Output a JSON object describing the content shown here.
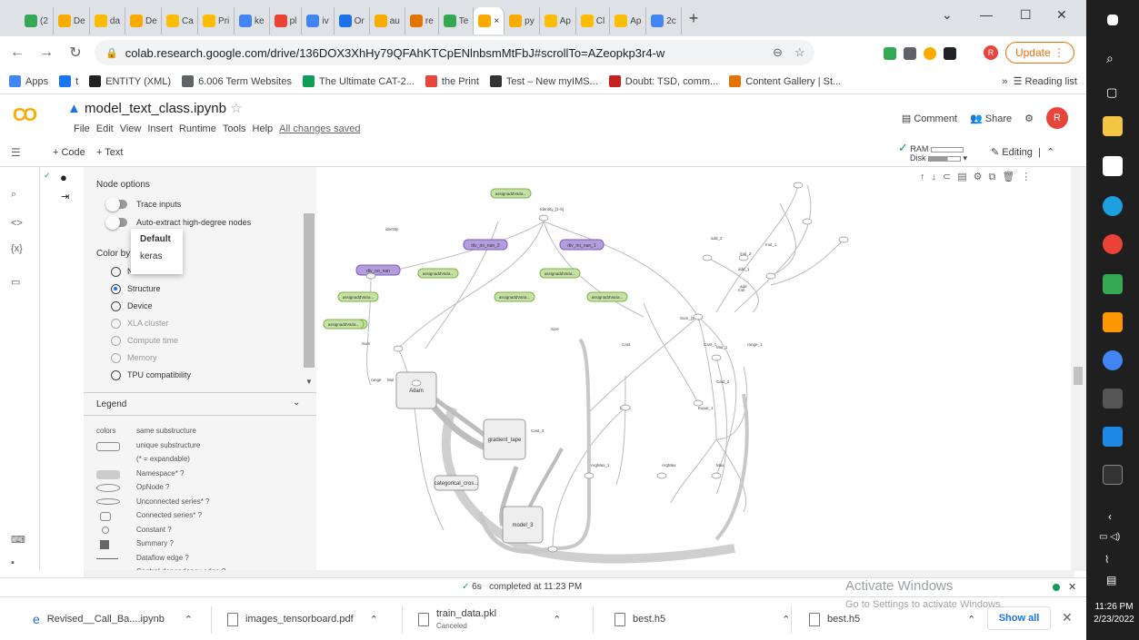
{
  "browser": {
    "tabs": [
      {
        "label": "(2",
        "color": "#34a853"
      },
      {
        "label": "De",
        "color": "#f9ab00"
      },
      {
        "label": "da",
        "color": "#fbbc04"
      },
      {
        "label": "De",
        "color": "#f9ab00"
      },
      {
        "label": "Ca",
        "color": "#fbbc04"
      },
      {
        "label": "Pri",
        "color": "#fbbc04"
      },
      {
        "label": "ke",
        "color": "#4285f4"
      },
      {
        "label": "pl",
        "color": "#ea4335"
      },
      {
        "label": "iv",
        "color": "#4285f4"
      },
      {
        "label": "Or",
        "color": "#1a73e8"
      },
      {
        "label": "au",
        "color": "#f9ab00"
      },
      {
        "label": "re",
        "color": "#e37400"
      },
      {
        "label": "Te",
        "color": "#34a853"
      },
      {
        "label": "×",
        "color": "#f9ab00",
        "active": true
      },
      {
        "label": "py",
        "color": "#f9ab00"
      },
      {
        "label": "Ap",
        "color": "#fbbc04"
      },
      {
        "label": "Cl",
        "color": "#fbbc04"
      },
      {
        "label": "Ap",
        "color": "#fbbc04"
      },
      {
        "label": "2c",
        "color": "#4285f4"
      }
    ],
    "url": "colab.research.google.com/drive/136DOX3XhHy79QFAhKTCpENlnbsmMtFbJ#scrollTo=AZeopkp3r4-w",
    "update_label": "Update",
    "profile_initial": "R",
    "bookmarks": [
      {
        "label": "Apps",
        "color": "#4285f4"
      },
      {
        "label": "t",
        "color": "#1877f2"
      },
      {
        "label": "ENTITY (XML)",
        "color": "#222222"
      },
      {
        "label": "6.006 Term Websites",
        "color": "#5f6368"
      },
      {
        "label": "The Ultimate CAT-2...",
        "color": "#0f9d58"
      },
      {
        "label": "the Print",
        "color": "#e8453c"
      },
      {
        "label": "Test – New myIMS...",
        "color": "#333333"
      },
      {
        "label": "Doubt: TSD, comm...",
        "color": "#c5221f"
      },
      {
        "label": "Content Gallery | St...",
        "color": "#e37400"
      }
    ],
    "reading_list": "Reading list"
  },
  "colab": {
    "notebook_title": "model_text_class.ipynb",
    "menus": [
      "File",
      "Edit",
      "View",
      "Insert",
      "Runtime",
      "Tools",
      "Help"
    ],
    "saved_status": "All changes saved",
    "comment_label": "Comment",
    "share_label": "Share",
    "user_initial": "R",
    "add_code": "+ Code",
    "add_text": "+ Text",
    "ram_label": "RAM",
    "disk_label": "Disk",
    "editing_label": "Editing"
  },
  "tensorboard": {
    "node_options_title": "Node options",
    "trace_inputs": "Trace inputs",
    "auto_extract": "Auto-extract high-degree nodes",
    "color_by_label": "Color by",
    "dropdown_options": [
      "Default",
      "keras"
    ],
    "color_options": [
      {
        "label": "N",
        "selected": false,
        "dim": false
      },
      {
        "label": "Structure",
        "selected": true,
        "dim": false
      },
      {
        "label": "Device",
        "selected": false,
        "dim": false
      },
      {
        "label": "XLA cluster",
        "selected": false,
        "dim": true
      },
      {
        "label": "Compute time",
        "selected": false,
        "dim": true
      },
      {
        "label": "Memory",
        "selected": false,
        "dim": true
      },
      {
        "label": "TPU compatibility",
        "selected": false,
        "dim": false
      }
    ],
    "legend_title": "Legend",
    "legend_items": [
      {
        "left": "colors",
        "text": "same substructure"
      },
      {
        "left": "",
        "text": "unique substructure"
      },
      {
        "left": "",
        "text": "(* = expandable)"
      },
      {
        "left": "",
        "text": "Namespace* ?"
      },
      {
        "left": "",
        "text": "OpNode ?"
      },
      {
        "left": "",
        "text": "Unconnected series* ?"
      },
      {
        "left": "",
        "text": "Connected series* ?"
      },
      {
        "left": "",
        "text": "Constant ?"
      },
      {
        "left": "",
        "text": "Summary ?"
      },
      {
        "left": "",
        "text": "Dataflow edge ?"
      },
      {
        "left": "",
        "text": "Control dependency edge ?"
      }
    ],
    "graph_nodes_green": [
      "assignaddVaria...",
      "assignaddVaria...",
      "assignaddVaria...",
      "assignaddVaria...",
      "assignaddVaria...",
      "assignaddVaria...",
      "assignaddVaria...",
      "assignaddVaria..."
    ],
    "graph_nodes_purple": [
      "div_no_nan_2",
      "div_no_nan_1",
      "div_no_nan"
    ],
    "graph_boxes": [
      "Adam",
      "gradient_tape",
      "categorical_cros...",
      "model_3"
    ],
    "graph_labels": [
      "Identity_[1-5]",
      "Sum_[1-4]",
      "Cast",
      "Cast_1",
      "Cast_2",
      "Cast_3",
      "Equal",
      "Equal_1",
      "ArgMax",
      "ArgMax_1",
      "Max",
      "Sum",
      "range",
      "Mul",
      "Size",
      "Mul_1",
      "range_1",
      "mul_1",
      "mul_2",
      "add_1",
      "add_2",
      "add",
      "mul",
      "identity"
    ]
  },
  "status": {
    "duration": "6s",
    "completed": "completed at 11:23 PM",
    "activate_title": "Activate Windows",
    "activate_sub": "Go to Settings to activate Windows."
  },
  "downloads": [
    {
      "name": "Revised__Call_Ba....ipynb",
      "sub": ""
    },
    {
      "name": "images_tensorboard.pdf",
      "sub": ""
    },
    {
      "name": "train_data.pkl",
      "sub": "Canceled"
    },
    {
      "name": "best.h5",
      "sub": ""
    },
    {
      "name": "best.h5",
      "sub": ""
    }
  ],
  "show_all": "Show all",
  "clock": {
    "time": "11:26 PM",
    "date": "2/23/2022"
  }
}
